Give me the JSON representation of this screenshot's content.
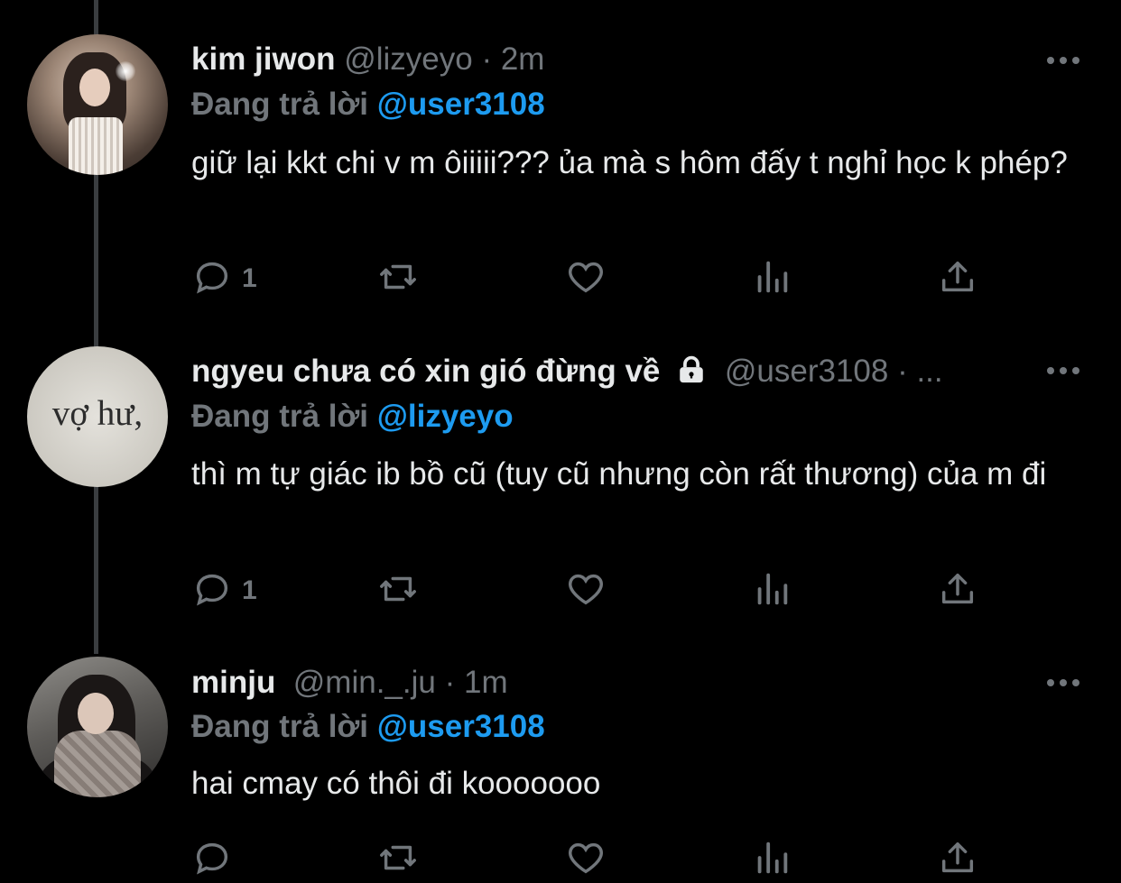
{
  "tweets": [
    {
      "name": "kim jiwon",
      "handle": "@lizyeyo",
      "time": "2m",
      "replying_label": "Đang trả lời",
      "replying_to": "@user3108",
      "text": "giữ lại kkt chi v m ôiiiii??? ủa mà s hôm đấy t nghỉ học k phép?",
      "reply_count": "1",
      "avatar_icon": "photo-avatar"
    },
    {
      "name": "ngyeu chưa có xin gió đừng về",
      "handle": "@user3108",
      "time": "· ...",
      "replying_label": "Đang trả lời",
      "replying_to": "@lizyeyo",
      "text": "thì m tự giác ib bồ cũ (tuy cũ nhưng còn rất thương) của m đi",
      "reply_count": "1",
      "avatar_text": "vợ hư,",
      "lock_icon": "lock-icon"
    },
    {
      "name": "minju",
      "handle": "@min._.ju",
      "time": "1m",
      "replying_label": "Đang trả lời",
      "replying_to": "@user3108",
      "text": "hai cmay có thôi đi kooooooo",
      "reply_count": ""
    }
  ],
  "colors": {
    "background": "#000000",
    "accent": "#1d9bf0",
    "muted": "#71767b",
    "text": "#e7e9ea"
  }
}
